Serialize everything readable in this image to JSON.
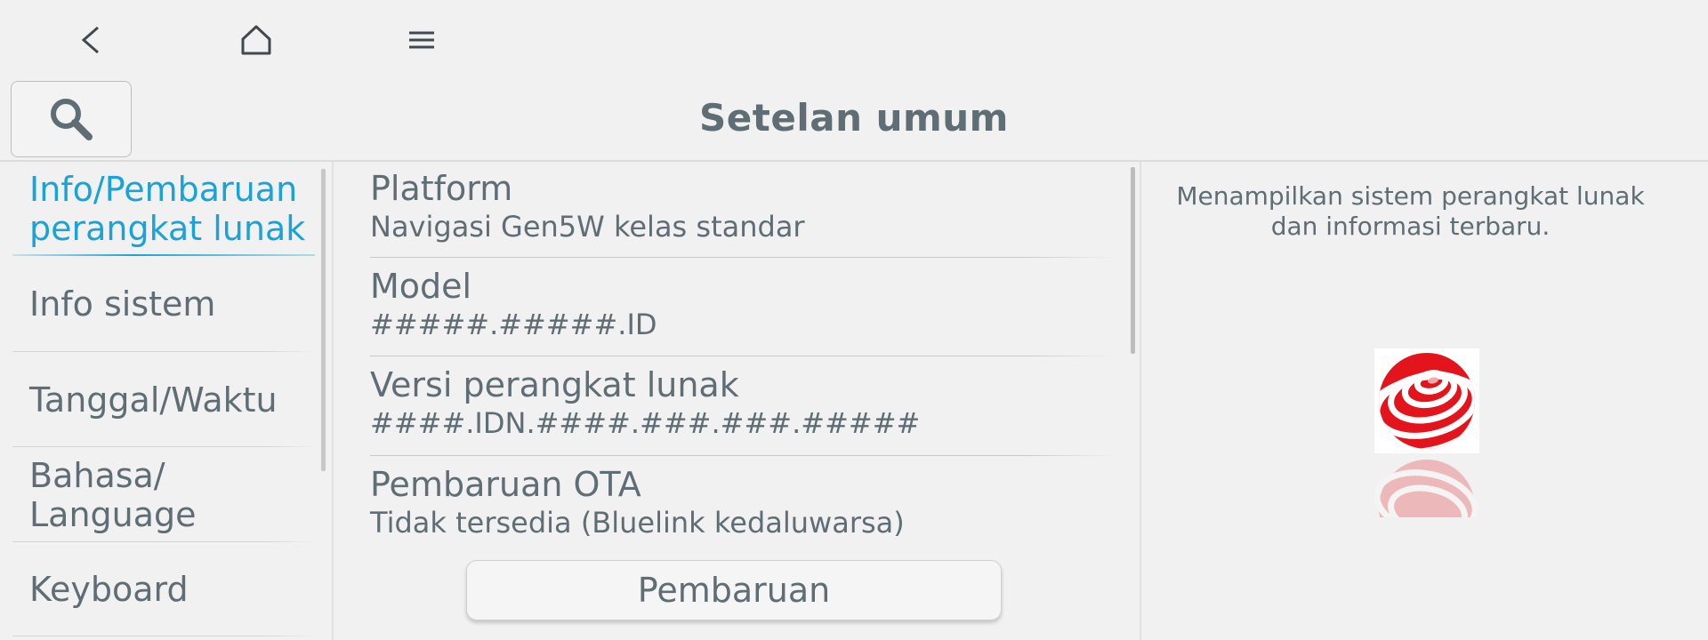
{
  "nav": {
    "back_icon": "chevron-left-icon",
    "home_icon": "home-icon",
    "menu_icon": "hamburger-menu-icon"
  },
  "header": {
    "title": "Setelan umum",
    "search_icon": "search-icon"
  },
  "sidebar": {
    "items": [
      {
        "label": "Info/Pembaruan perangkat lunak",
        "active": true
      },
      {
        "label": "Info sistem"
      },
      {
        "label": "Tanggal/Waktu"
      },
      {
        "label": "Bahasa/ Language"
      },
      {
        "label": "Keyboard"
      }
    ]
  },
  "main": {
    "rows": [
      {
        "label": "Platform",
        "value": "Navigasi Gen5W kelas standar"
      },
      {
        "label": "Model",
        "value": "#####.#####.ID"
      },
      {
        "label": "Versi perangkat lunak",
        "value": "####.IDN.####.###.###.#####"
      },
      {
        "label": "Pembaruan OTA",
        "value": "Tidak tersedia (Bluelink kedaluwarsa)"
      }
    ],
    "update_button": "Pembaruan"
  },
  "info_panel": {
    "description": "Menampilkan sistem perangkat lunak dan informasi terbaru.",
    "logo_icon": "red-dot-logo-icon"
  },
  "colors": {
    "accent": "#1aa3d6",
    "text": "#5f6d75",
    "background": "#f1f1f1",
    "logo": "#e3141b"
  }
}
